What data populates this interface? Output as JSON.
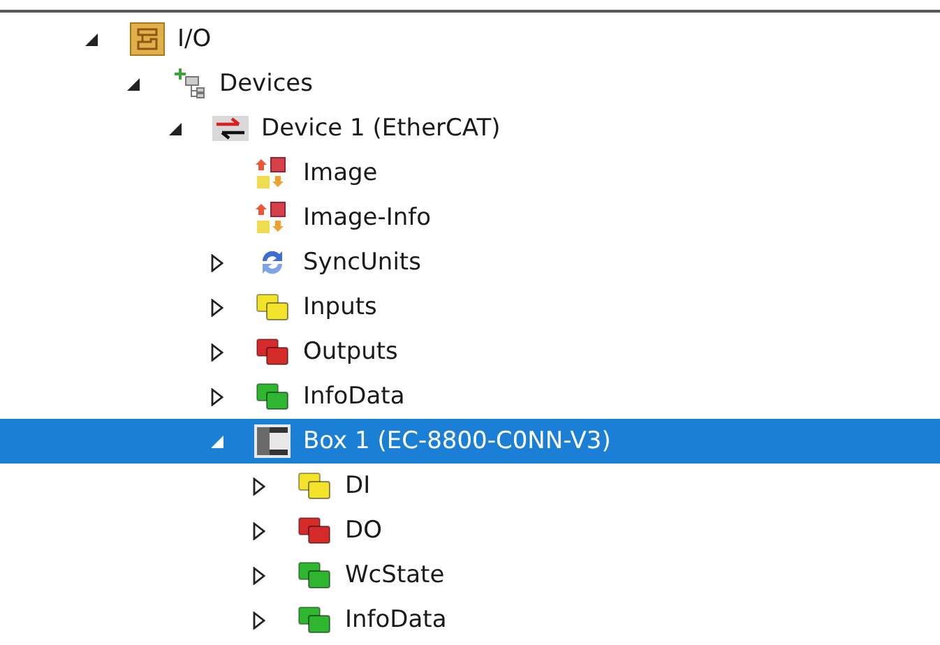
{
  "tree": [
    {
      "label": "I/O",
      "kind": "io",
      "expanded": true,
      "selected": false,
      "children": [
        {
          "label": "Devices",
          "kind": "devices",
          "expanded": true,
          "selected": false,
          "children": [
            {
              "label": "Device 1 (EtherCAT)",
              "kind": "ethercat",
              "expanded": true,
              "selected": false,
              "children": [
                {
                  "label": "Image",
                  "kind": "image",
                  "selected": false
                },
                {
                  "label": "Image-Info",
                  "kind": "image",
                  "selected": false
                },
                {
                  "label": "SyncUnits",
                  "kind": "sync",
                  "expanded": false,
                  "selected": false
                },
                {
                  "label": "Inputs",
                  "kind": "stack",
                  "color": "#f2e22a",
                  "expanded": false,
                  "selected": false
                },
                {
                  "label": "Outputs",
                  "kind": "stack",
                  "color": "#d42a2a",
                  "expanded": false,
                  "selected": false
                },
                {
                  "label": "InfoData",
                  "kind": "stack",
                  "color": "#2fb52f",
                  "expanded": false,
                  "selected": false
                },
                {
                  "label": "Box 1 (EC-8800-C0NN-V3)",
                  "kind": "box",
                  "expanded": true,
                  "selected": true,
                  "children": [
                    {
                      "label": "DI",
                      "kind": "stack",
                      "color": "#f2e22a",
                      "expanded": false,
                      "selected": false
                    },
                    {
                      "label": "DO",
                      "kind": "stack",
                      "color": "#d42a2a",
                      "expanded": false,
                      "selected": false
                    },
                    {
                      "label": "WcState",
                      "kind": "stack",
                      "color": "#2fb52f",
                      "expanded": false,
                      "selected": false
                    },
                    {
                      "label": "InfoData",
                      "kind": "stack",
                      "color": "#2fb52f",
                      "expanded": false,
                      "selected": false
                    }
                  ]
                }
              ]
            }
          ]
        }
      ]
    }
  ]
}
